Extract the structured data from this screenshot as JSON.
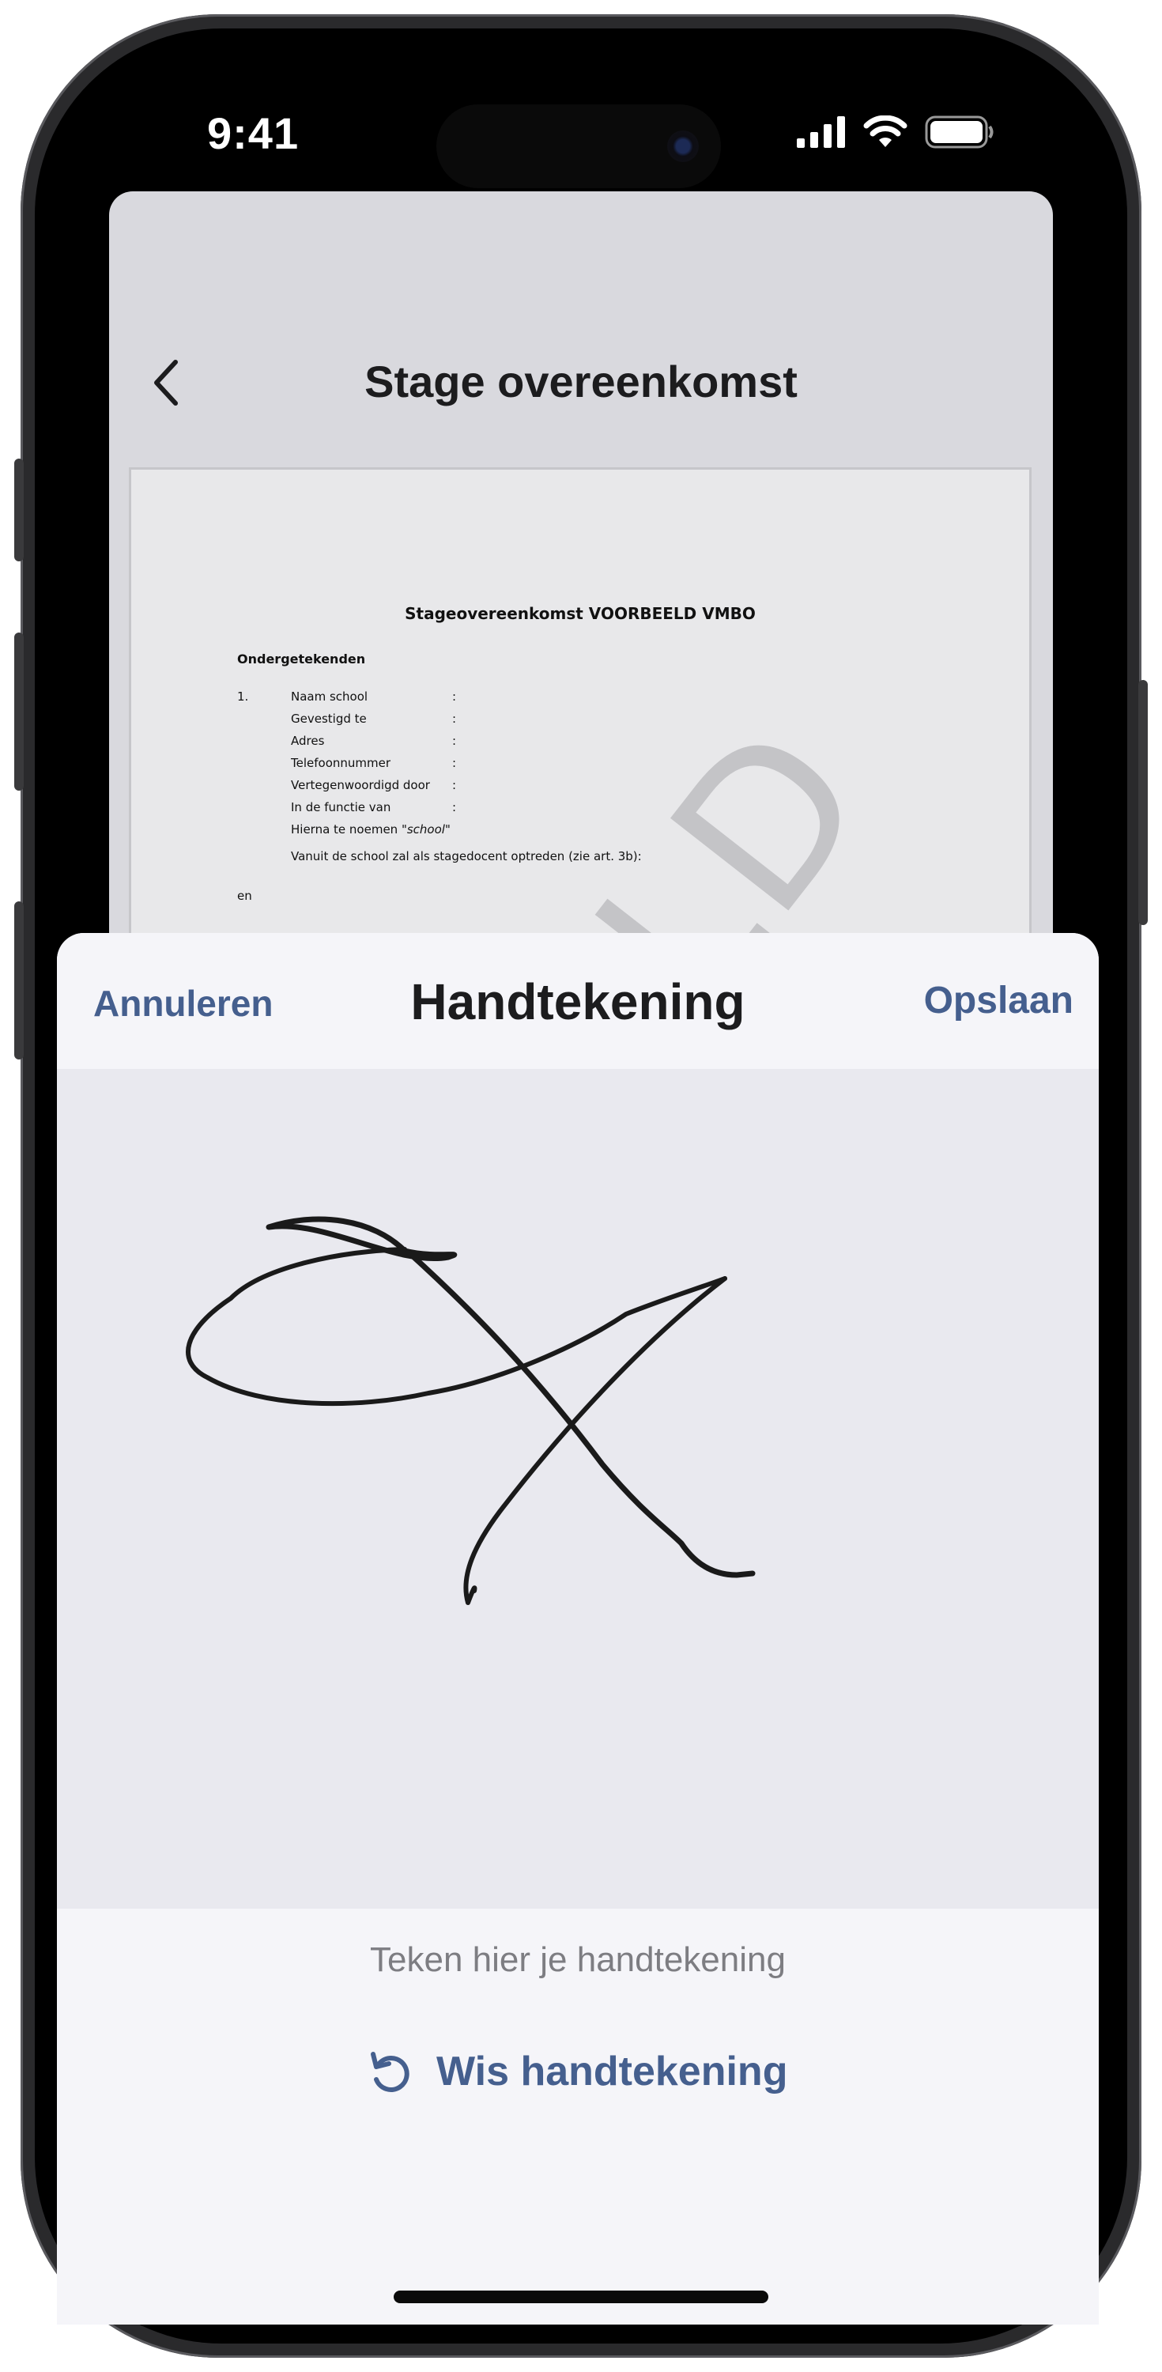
{
  "status_bar": {
    "time": "9:41",
    "icons": [
      "cellular-signal-icon",
      "wifi-icon",
      "battery-icon"
    ]
  },
  "background_screen": {
    "title": "Stage overeenkomst",
    "back_icon": "chevron-left-icon",
    "document": {
      "title": "Stageovereenkomst VOORBEELD VMBO",
      "section_heading": "Ondergetekenden",
      "number": "1.",
      "fields": [
        "Naam school",
        "Gevestigd te",
        "Adres",
        "Telefoonnummer",
        "Vertegenwoordigd door",
        "In de functie van"
      ],
      "colon": ":",
      "hierna_prefix": "Hierna te noemen ",
      "hierna_italic": "\"school\"",
      "vanuit": "Vanuit de school zal als stagedocent optreden (zie art. 3b):",
      "en": "en",
      "watermark": "LD"
    }
  },
  "sheet": {
    "cancel_label": "Annuleren",
    "title": "Handtekening",
    "save_label": "Opslaan",
    "hint": "Teken hier je handtekening",
    "clear_label": "Wis handtekening",
    "clear_icon": "undo-icon"
  },
  "colors": {
    "accent": "#455f8e",
    "sheet_background": "#f5f5f9",
    "signature_pad": "#e9e9ef",
    "hint_text": "#7d7d82"
  }
}
